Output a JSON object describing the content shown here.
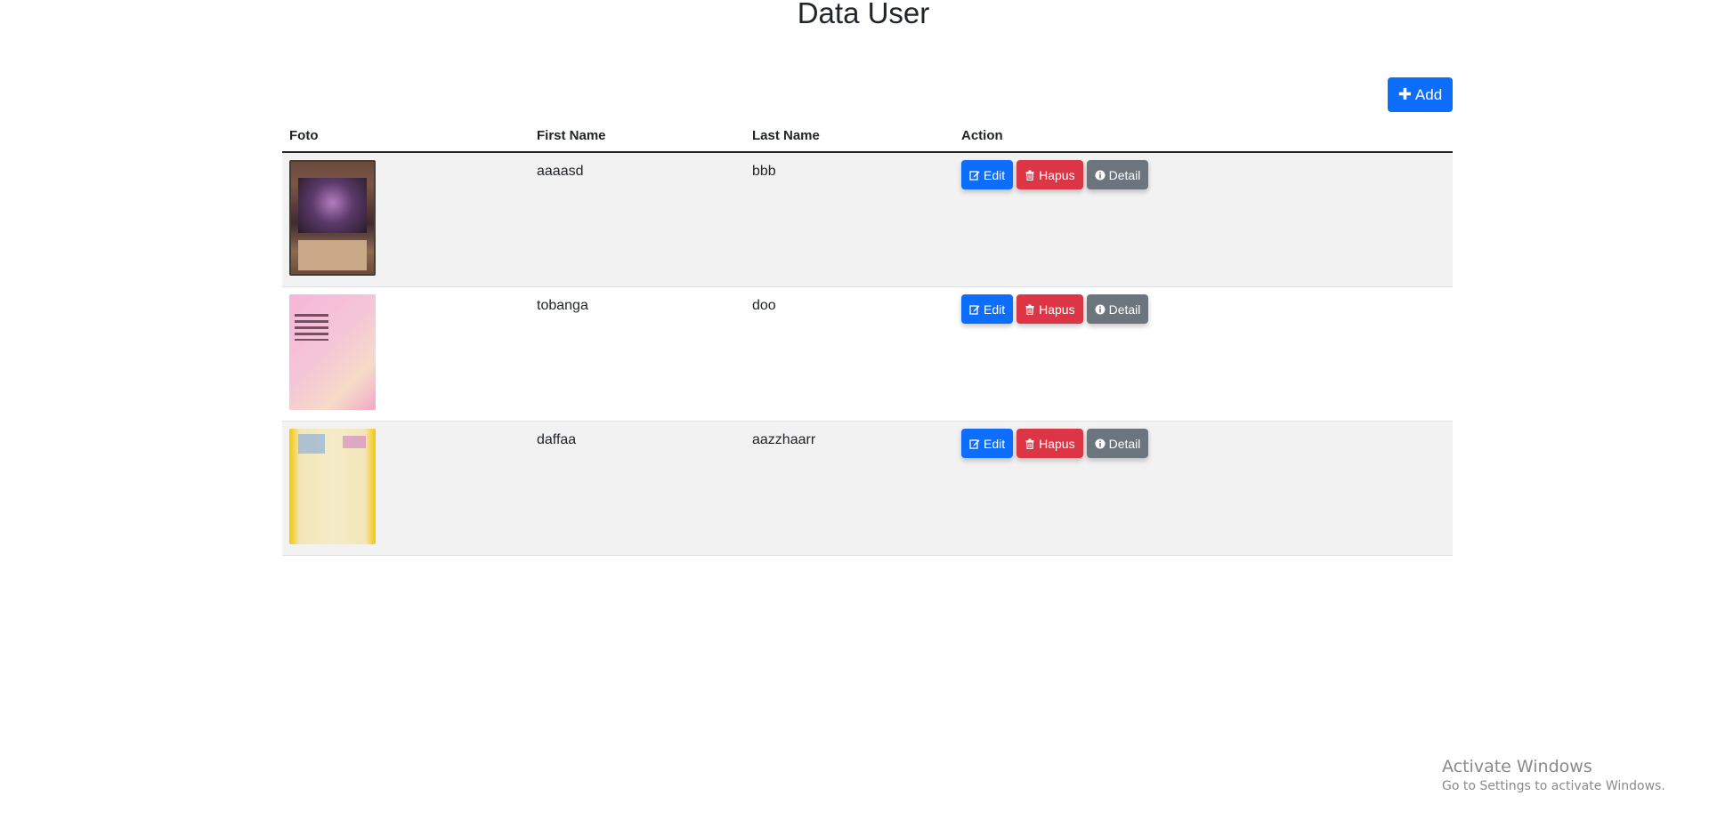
{
  "page": {
    "title": "Data User"
  },
  "toolbar": {
    "add_label": "Add",
    "add_icon": "plus-icon",
    "accent": "#0d6efd"
  },
  "table": {
    "headers": [
      "Foto",
      "First Name",
      "Last Name",
      "Action"
    ],
    "rows": [
      {
        "photo": "trading-card-image",
        "first_name": "aaaasd",
        "last_name": "bbb"
      },
      {
        "photo": "pink-poster-image",
        "first_name": "tobanga",
        "last_name": "doo"
      },
      {
        "photo": "yellow-poster-image",
        "first_name": "daffaa",
        "last_name": "aazzhaarr"
      }
    ],
    "actions": {
      "edit_label": "Edit",
      "edit_icon": "edit-icon",
      "edit_color": "#0d6efd",
      "hapus_label": "Hapus",
      "hapus_icon": "trash-icon",
      "hapus_color": "#dc3545",
      "detail_label": "Detail",
      "detail_icon": "info-icon",
      "detail_color": "#6c757d"
    }
  },
  "watermark": {
    "title": "Activate Windows",
    "subtitle": "Go to Settings to activate Windows."
  }
}
